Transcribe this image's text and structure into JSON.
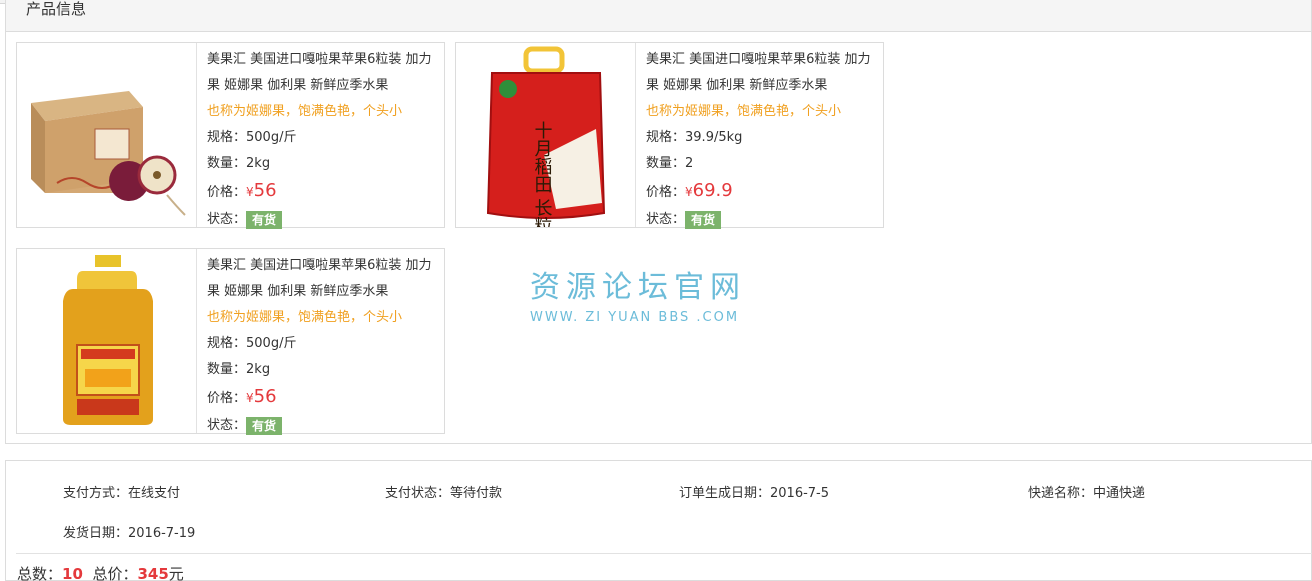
{
  "panel": {
    "title": "产品信息"
  },
  "labels": {
    "spec": "规格：",
    "qty": "数量：",
    "price": "价格：",
    "yen": "¥",
    "status": "状态："
  },
  "products": [
    {
      "name": "美果汇 美国进口嘎啦果苹果6粒装 加力果 姬娜果 伽利果 新鲜应季水果",
      "desc": "也称为姬娜果，饱满色艳，个头小",
      "spec": "500g/斤",
      "qty": "2kg",
      "price": "56",
      "status": "有货",
      "image": "apple-gift-box"
    },
    {
      "name": "美果汇 美国进口嘎啦果苹果6粒装 加力果 姬娜果 伽利果 新鲜应季水果",
      "desc": "也称为姬娜果，饱满色艳，个头小",
      "spec": "39.9/5kg",
      "qty": "2",
      "price": "69.9",
      "status": "有货",
      "image": "rice-bag",
      "image_text": "十月稻田 长粒香"
    },
    {
      "name": "美果汇 美国进口嘎啦果苹果6粒装 加力果 姬娜果 伽利果 新鲜应季水果",
      "desc": "也称为姬娜果，饱满色艳，个头小",
      "spec": "500g/斤",
      "qty": "2kg",
      "price": "56",
      "status": "有货",
      "image": "oil-bottle"
    }
  ],
  "watermark": {
    "cn": "资源论坛官网",
    "en": "WWW. ZI YUAN BBS .COM"
  },
  "order": {
    "pay_method": "支付方式：在线支付",
    "pay_status": "支付状态：等待付款",
    "created": "订单生成日期：2016-7-5",
    "courier": "快递名称：中通快递",
    "shipped": "发货日期：2016-7-19",
    "total_count_label": "总数：",
    "total_count": "10",
    "total_price_label": "总价：",
    "total_price": "345",
    "currency": "元"
  },
  "colors": {
    "price": "#e4393c",
    "desc": "#f0a020",
    "badge": "#7cb36b",
    "watermark": "#6cbcd9"
  }
}
